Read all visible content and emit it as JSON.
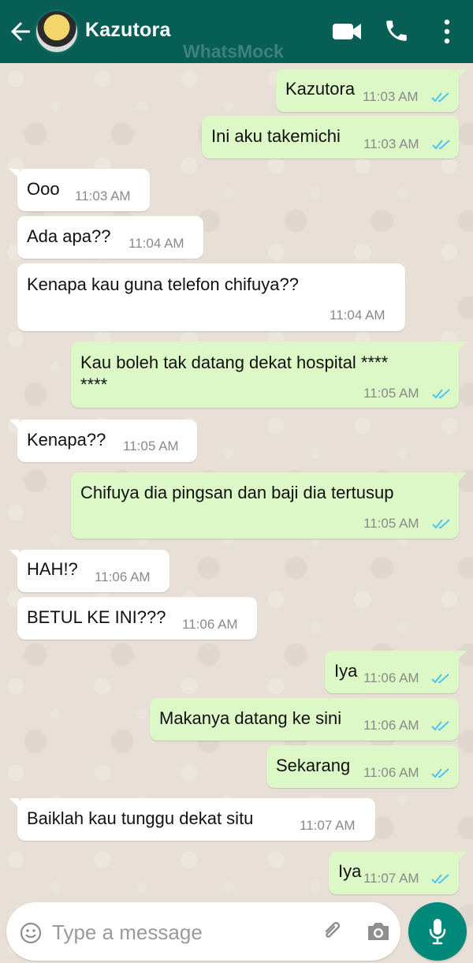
{
  "header": {
    "title": "Kazutora",
    "watermark": "WhatsMock"
  },
  "messages": [
    {
      "direction": "out",
      "text": "Kazutora",
      "time": "11:03 AM",
      "status": "read"
    },
    {
      "direction": "out",
      "text": "Ini aku takemichi",
      "time": "11:03 AM",
      "status": "read"
    },
    {
      "direction": "in",
      "text": "Ooo",
      "time": "11:03 AM"
    },
    {
      "direction": "in",
      "text": "Ada apa??",
      "time": "11:04 AM"
    },
    {
      "direction": "in",
      "text": "Kenapa kau guna telefon chifuya??",
      "time": "11:04 AM"
    },
    {
      "direction": "out",
      "text": "Kau boleh tak datang dekat hospital ****\n****",
      "time": "11:05 AM",
      "status": "read"
    },
    {
      "direction": "in",
      "text": "Kenapa??",
      "time": "11:05 AM"
    },
    {
      "direction": "out",
      "text": "Chifuya dia pingsan dan baji dia tertusup",
      "time": "11:05 AM",
      "status": "read"
    },
    {
      "direction": "in",
      "text": "HAH!?",
      "time": "11:06 AM"
    },
    {
      "direction": "in",
      "text": "BETUL KE INI???",
      "time": "11:06 AM"
    },
    {
      "direction": "out",
      "text": "Iya",
      "time": "11:06 AM",
      "status": "read"
    },
    {
      "direction": "out",
      "text": "Makanya datang ke sini",
      "time": "11:06 AM",
      "status": "read"
    },
    {
      "direction": "out",
      "text": "Sekarang",
      "time": "11:06 AM",
      "status": "read"
    },
    {
      "direction": "in",
      "text": "Baiklah kau tunggu dekat situ",
      "time": "11:07 AM"
    },
    {
      "direction": "out",
      "text": "Iya",
      "time": "11:07 AM",
      "status": "read"
    }
  ],
  "composer": {
    "placeholder": "Type a message"
  },
  "colors": {
    "header": "#075e54",
    "outgoing_bubble": "#dcf8c6",
    "incoming_bubble": "#ffffff",
    "read_ticks": "#4fc3f7",
    "mic_button": "#00897b"
  },
  "icons": [
    "back-arrow-icon",
    "video-call-icon",
    "phone-icon",
    "more-vert-icon",
    "emoji-icon",
    "attach-icon",
    "camera-icon",
    "mic-icon"
  ]
}
